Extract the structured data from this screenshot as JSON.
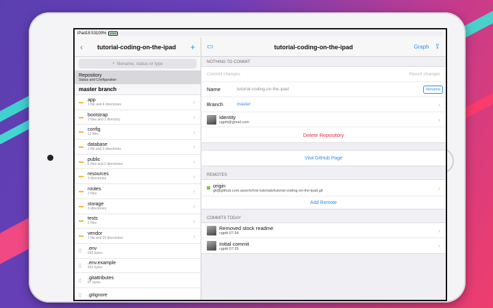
{
  "statusbar": {
    "carrier": "iPad",
    "time": "18:53",
    "battery": "100%"
  },
  "sidebar": {
    "title": "tutorial-coding-on-the-ipad",
    "search_placeholder": "filename, status or type",
    "repository": {
      "title": "Repository",
      "subtitle": "Status and Configuration"
    },
    "branch_header": "master branch",
    "items": [
      {
        "name": "app",
        "meta": "1 file and 4 directories",
        "type": "folder"
      },
      {
        "name": "bootstrap",
        "meta": "2 files and 1 directory",
        "type": "folder"
      },
      {
        "name": "config",
        "meta": "12 files",
        "type": "folder"
      },
      {
        "name": "database",
        "meta": "1 file and 3 directories",
        "type": "folder"
      },
      {
        "name": "public",
        "meta": "5 files and 2 directories",
        "type": "folder"
      },
      {
        "name": "resources",
        "meta": "3 directories",
        "type": "folder"
      },
      {
        "name": "routes",
        "meta": "3 files",
        "type": "folder"
      },
      {
        "name": "storage",
        "meta": "3 directories",
        "type": "folder"
      },
      {
        "name": "tests",
        "meta": "2 files",
        "type": "folder"
      },
      {
        "name": "vendor",
        "meta": "1 file and 30 directories",
        "type": "folder"
      },
      {
        "name": ".env",
        "meta": "643 bytes",
        "type": "file"
      },
      {
        "name": ".env.example",
        "meta": "491 bytes",
        "type": "file"
      },
      {
        "name": ".gitattributes",
        "meta": "87 bytes",
        "type": "file"
      },
      {
        "name": ".gitignore",
        "meta": "",
        "type": "file"
      }
    ]
  },
  "detail": {
    "title": "tutorial-coding-on-the-ipad",
    "graph_label": "Graph",
    "nothing_to_commit": "NOTHING TO COMMIT",
    "commit_changes": "Commit changes",
    "revert_changes": "Revert changes",
    "name_label": "Name",
    "name_value": "tutorial-coding-on-the-ipad",
    "rename_label": "Rename",
    "branch_label": "Branch",
    "branch_value": "master",
    "identity_title": "Identity",
    "identity_email": "cgpitt@gmail.com",
    "delete_repo": "Delete Repository",
    "visit_github": "Visit GitHub Page",
    "remotes_label": "REMOTES",
    "remote_name": "origin",
    "remote_url": "git@github.com:assertchris-tutorials/tutorial-coding-on-the-ipad.git",
    "add_remote": "Add Remote",
    "commits_label": "COMMITS TODAY",
    "commits": [
      {
        "message": "Removed stock readme",
        "meta": "cgpitt 07:34"
      },
      {
        "message": "Initial commit",
        "meta": "cgpitt 07:29"
      }
    ]
  },
  "colors": {
    "accent": "#2e8ae6",
    "destructive": "#e0304a",
    "folder": "#f0b83c"
  }
}
